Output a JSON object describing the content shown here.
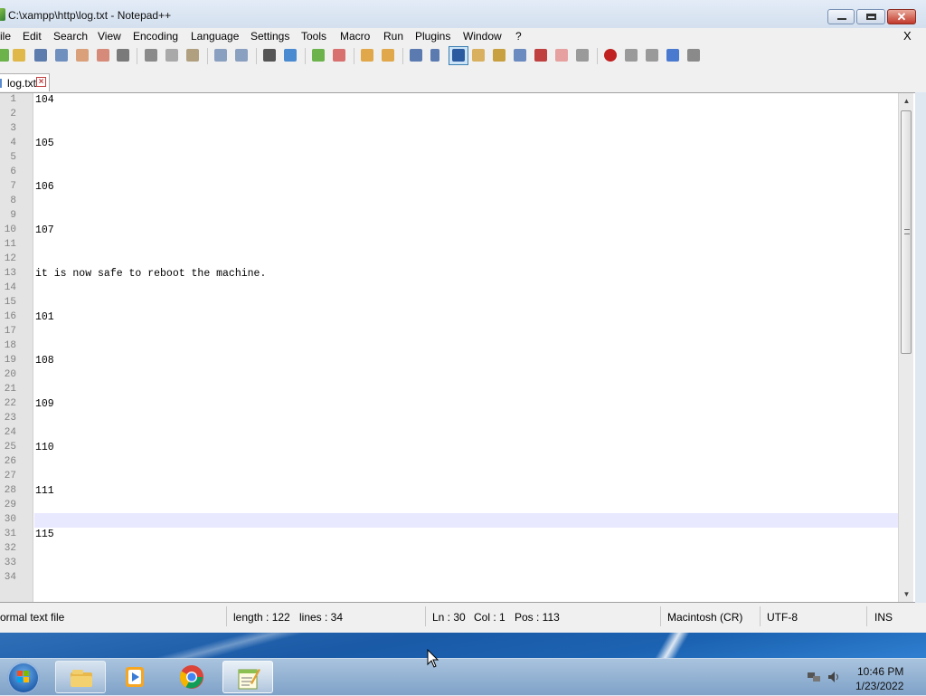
{
  "window": {
    "title": "C:\\xampp\\http\\log.txt - Notepad++",
    "close_glyph": "✕"
  },
  "menu": {
    "items": [
      "ile",
      "Edit",
      "Search",
      "View",
      "Encoding",
      "Language",
      "Settings",
      "Tools",
      "Macro",
      "Run",
      "Plugins",
      "Window",
      "?"
    ],
    "close_label": "X"
  },
  "tab": {
    "label": "log.txt",
    "close_glyph": "×"
  },
  "editor": {
    "line_numbers": [
      "1",
      "2",
      "3",
      "4",
      "5",
      "6",
      "7",
      "8",
      "9",
      "10",
      "11",
      "12",
      "13",
      "14",
      "15",
      "16",
      "17",
      "18",
      "19",
      "20",
      "21",
      "22",
      "23",
      "24",
      "25",
      "26",
      "27",
      "28",
      "29",
      "30",
      "31",
      "32",
      "33",
      "34"
    ],
    "lines": [
      {
        "n": 1,
        "text": "104"
      },
      {
        "n": 4,
        "text": "105"
      },
      {
        "n": 7,
        "text": "106"
      },
      {
        "n": 10,
        "text": "107"
      },
      {
        "n": 13,
        "text": "it is now safe to reboot the machine."
      },
      {
        "n": 16,
        "text": "101"
      },
      {
        "n": 19,
        "text": "108"
      },
      {
        "n": 22,
        "text": "109"
      },
      {
        "n": 25,
        "text": "110"
      },
      {
        "n": 28,
        "text": "111"
      },
      {
        "n": 31,
        "text": "115"
      }
    ],
    "current_line": 30,
    "scroll_up_glyph": "▲",
    "scroll_down_glyph": "▼"
  },
  "status": {
    "file_type": "ormal text file",
    "length": "length : 122",
    "lines": "lines : 34",
    "ln": "Ln : 30",
    "col": "Col : 1",
    "pos": "Pos : 113",
    "eol": "Macintosh (CR)",
    "encoding": "UTF-8",
    "mode": "INS"
  },
  "taskbar": {
    "apps": [
      "windows-explorer-icon",
      "media-player-icon",
      "chrome-icon",
      "notepad-plus-plus-icon"
    ],
    "clock_time": "10:46 PM",
    "clock_date": "1/23/2022"
  }
}
